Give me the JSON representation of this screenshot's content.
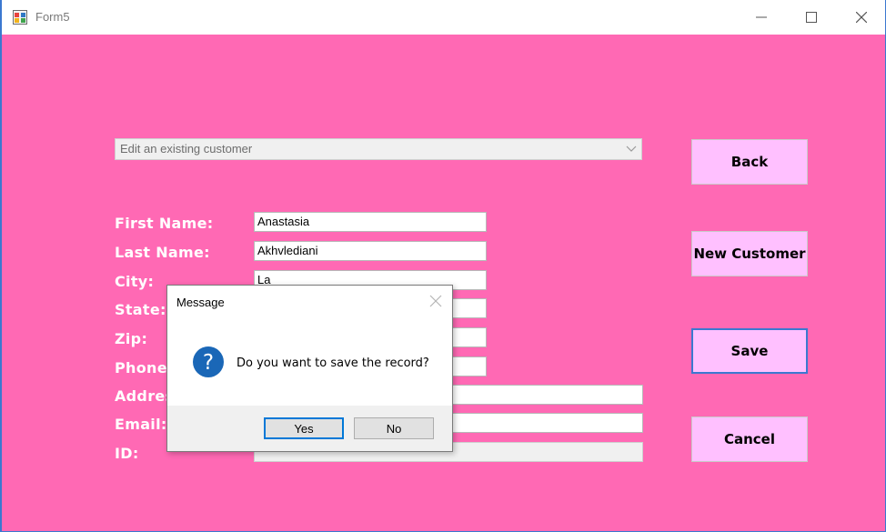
{
  "window": {
    "title": "Form5"
  },
  "form": {
    "mode_select": {
      "selected": "Edit an existing customer"
    },
    "labels": {
      "first_name": "First Name:",
      "last_name": "Last Name:",
      "city": "City:",
      "state": "State:",
      "zip": "Zip:",
      "phone": "Phone:",
      "address": "Address:",
      "email": "Email:",
      "id": "ID:"
    },
    "values": {
      "first_name": "Anastasia",
      "last_name": "Akhvlediani",
      "city": "La",
      "state": "",
      "zip": "",
      "phone": "",
      "address": "",
      "email": "",
      "id": ""
    }
  },
  "buttons": {
    "back": "Back",
    "new_customer": "New Customer",
    "save": "Save",
    "cancel": "Cancel"
  },
  "dialog": {
    "title": "Message",
    "message": "Do you want to save the record?",
    "icon": "question-icon",
    "yes": "Yes",
    "no": "No"
  },
  "colors": {
    "form_background": "#ff69b4",
    "button_background": "#ffc0ff",
    "focus_border": "#3b78d0",
    "question_icon": "#1a67b7"
  }
}
